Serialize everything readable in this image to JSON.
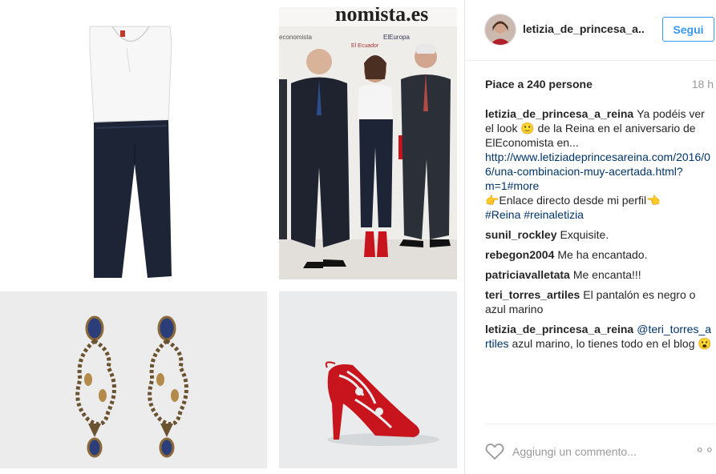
{
  "post": {
    "username": "letizia_de_princesa_a..",
    "follow_label": "Segui",
    "likes_text": "Piace a 240 persone",
    "time_ago": "18 h",
    "photo_text": {
      "banner_fragment": "nomista.es",
      "logo_1": "economista",
      "logo_2": "El Ecuador",
      "logo_3": "ElEuropa"
    }
  },
  "comments": [
    {
      "author": "letizia_de_princesa_a_reina",
      "lines": [
        "Ya podéis ver el look 🙂 de la Reina en el aniversario de ElEconomista en...",
        "http://www.letiziadeprincesareina.com/2016/06/una-combinacion-muy-acertada.html?m=1#more",
        "👉Enlace directo desde mi perfil👈",
        "#Reina #reinaletizia"
      ]
    },
    {
      "author": "sunil_rockley",
      "text": "Exquisite."
    },
    {
      "author": "rebegon2004",
      "text": "Me ha encantado."
    },
    {
      "author": "patriciavalletata",
      "text": "Me encanta!!!"
    },
    {
      "author": "teri_torres_artiles",
      "text": "El pantalón es negro o azul marino"
    },
    {
      "author": "letizia_de_princesa_a_reina",
      "mention": "@teri_torres_artiles",
      "text": "azul marino, lo tienes todo en el blog 😮"
    }
  ],
  "footer": {
    "comment_placeholder": "Aggiungi un commento...",
    "more_label": "∘∘∘"
  },
  "icons": {
    "like": "heart-icon",
    "more": "more-options-icon"
  },
  "colors": {
    "accent": "#3897f0",
    "link": "#003569",
    "muted": "#999999",
    "text": "#262626",
    "shoe_red": "#c8141c",
    "trouser_navy": "#1c2436"
  }
}
